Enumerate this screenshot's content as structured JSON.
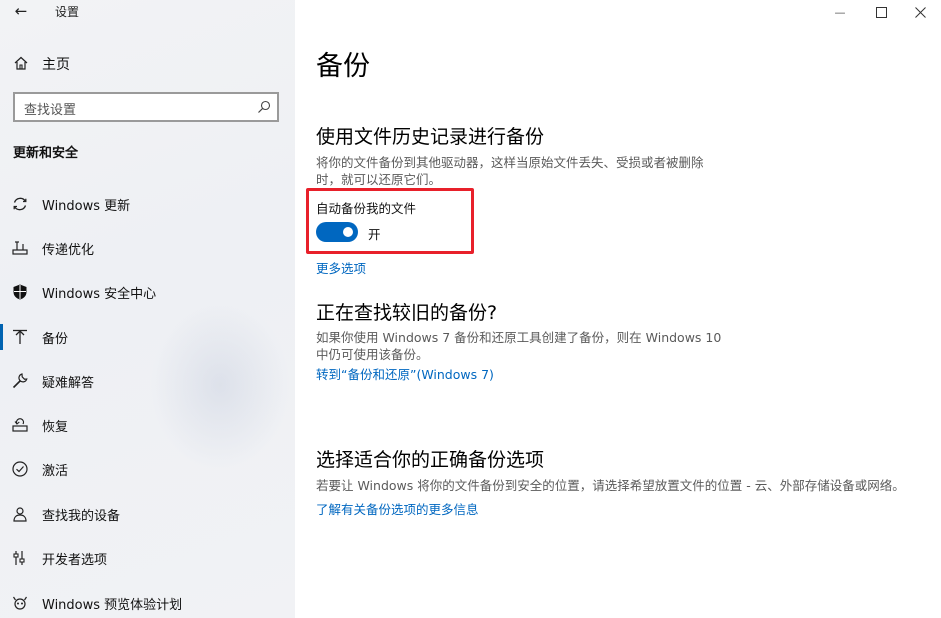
{
  "window": {
    "title": "设置",
    "controls": {
      "minimize": "—",
      "maximize": "☐",
      "close": "✕"
    }
  },
  "sidebar": {
    "home_label": "主页",
    "search_placeholder": "查找设置",
    "section_title": "更新和安全",
    "items": [
      {
        "label": "Windows 更新",
        "icon": "sync-icon"
      },
      {
        "label": "传递优化",
        "icon": "delivery-optimization-icon"
      },
      {
        "label": "Windows 安全中心",
        "icon": "shield-icon"
      },
      {
        "label": "备份",
        "icon": "backup-arrow-icon",
        "selected": true
      },
      {
        "label": "疑难解答",
        "icon": "wrench-icon"
      },
      {
        "label": "恢复",
        "icon": "recovery-icon"
      },
      {
        "label": "激活",
        "icon": "activation-check-icon"
      },
      {
        "label": "查找我的设备",
        "icon": "find-device-icon"
      },
      {
        "label": "开发者选项",
        "icon": "developer-icon"
      },
      {
        "label": "Windows 预览体验计划",
        "icon": "insider-icon"
      }
    ]
  },
  "main": {
    "page_title": "备份",
    "file_history": {
      "heading": "使用文件历史记录进行备份",
      "description_line1": "将你的文件备份到其他驱动器，这样当原始文件丢失、受损或者被删除",
      "description_line2": "时，就可以还原它们。",
      "toggle_label": "自动备份我的文件",
      "toggle_state": "开",
      "toggle_on": true,
      "more_options_link": "更多选项"
    },
    "older_backup": {
      "heading": "正在查找较旧的备份?",
      "description_line1": "如果你使用 Windows 7 备份和还原工具创建了备份，则在 Windows 10",
      "description_line2": "中仍可使用该备份。",
      "link": "转到“备份和还原”(Windows 7)"
    },
    "right_option": {
      "heading": "选择适合你的正确备份选项",
      "description": "若要让 Windows 将你的文件备份到安全的位置，请选择希望放置文件的位置 - 云、外部存储设备或网络。",
      "link": "了解有关备份选项的更多信息"
    }
  },
  "colors": {
    "accent": "#0067c0",
    "highlight_border": "#e8202a",
    "sidebar_bg": "#f1f2f5"
  }
}
